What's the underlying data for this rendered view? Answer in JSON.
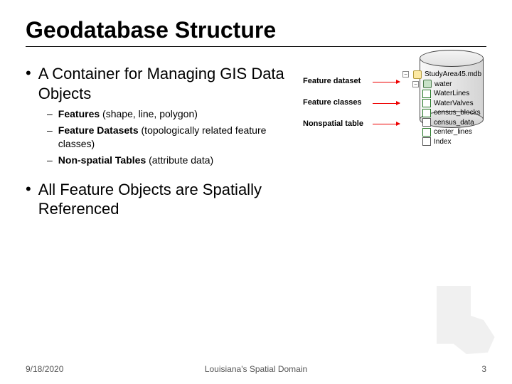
{
  "title": "Geodatabase Structure",
  "bullets": {
    "b1": "A Container for Managing GIS Data Objects",
    "sub": {
      "s1_bold": "Features",
      "s1_rest": " (shape, line, polygon)",
      "s2_bold": "Feature Datasets",
      "s2_rest": " (topologically related feature classes)",
      "s3_bold": "Non-spatial Tables",
      "s3_rest": " (attribute data)"
    },
    "b2": "All Feature Objects are Spatially Referenced"
  },
  "diagram_labels": {
    "feature_dataset": "Feature dataset",
    "feature_classes": "Feature classes",
    "nonspatial_table": "Nonspatial table"
  },
  "tree": {
    "root": "StudyArea45.mdb",
    "dataset": "water",
    "items": [
      "WaterLines",
      "WaterValves",
      "census_blocks",
      "census_data",
      "center_lines",
      "Index"
    ],
    "expander_root": "−",
    "expander_ds": "−"
  },
  "footer": {
    "date": "9/18/2020",
    "title": "Louisiana's Spatial Domain",
    "page": "3"
  }
}
